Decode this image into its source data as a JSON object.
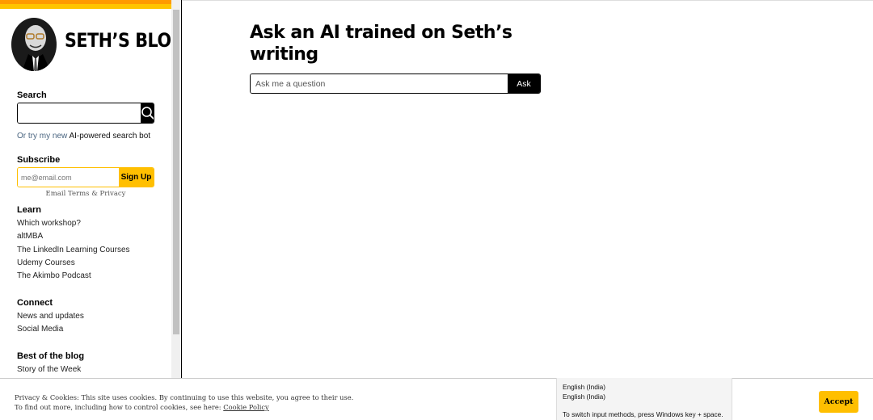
{
  "blog": {
    "title": "SETH’S BLOG"
  },
  "search": {
    "heading": "Search",
    "placeholder": "",
    "ai_prefix": "Or try my new ",
    "ai_link": "AI-powered search bot"
  },
  "subscribe": {
    "heading": "Subscribe",
    "placeholder": "me@email.com",
    "button": "Sign Up",
    "terms": "Email Terms & Privacy"
  },
  "learn": {
    "heading": "Learn",
    "items": [
      "Which workshop?",
      "altMBA",
      "The LinkedIn Learning Courses",
      "Udemy Courses",
      "The Akimbo Podcast"
    ]
  },
  "connect": {
    "heading": "Connect",
    "items": [
      "News and updates",
      "Social Media"
    ]
  },
  "best": {
    "heading": "Best of the blog",
    "items": [
      "Story of the Week"
    ]
  },
  "main": {
    "title": "Ask an AI trained on Seth’s writing",
    "placeholder": "Ask me a question",
    "button": "Ask"
  },
  "cookie": {
    "line1": "Privacy & Cookies: This site uses cookies. By continuing to use this website, you agree to their use.",
    "line2_prefix": "To find out more, including how to control cookies, see here: ",
    "policy_link": "Cookie Policy",
    "accept": "Accept"
  },
  "ime": {
    "line1": "English (India)",
    "line2": "English (India)",
    "line3": "To switch input methods, press Windows key + space."
  },
  "colors": {
    "accent": "#ffbf00",
    "top_orange": "#ff9a00"
  }
}
